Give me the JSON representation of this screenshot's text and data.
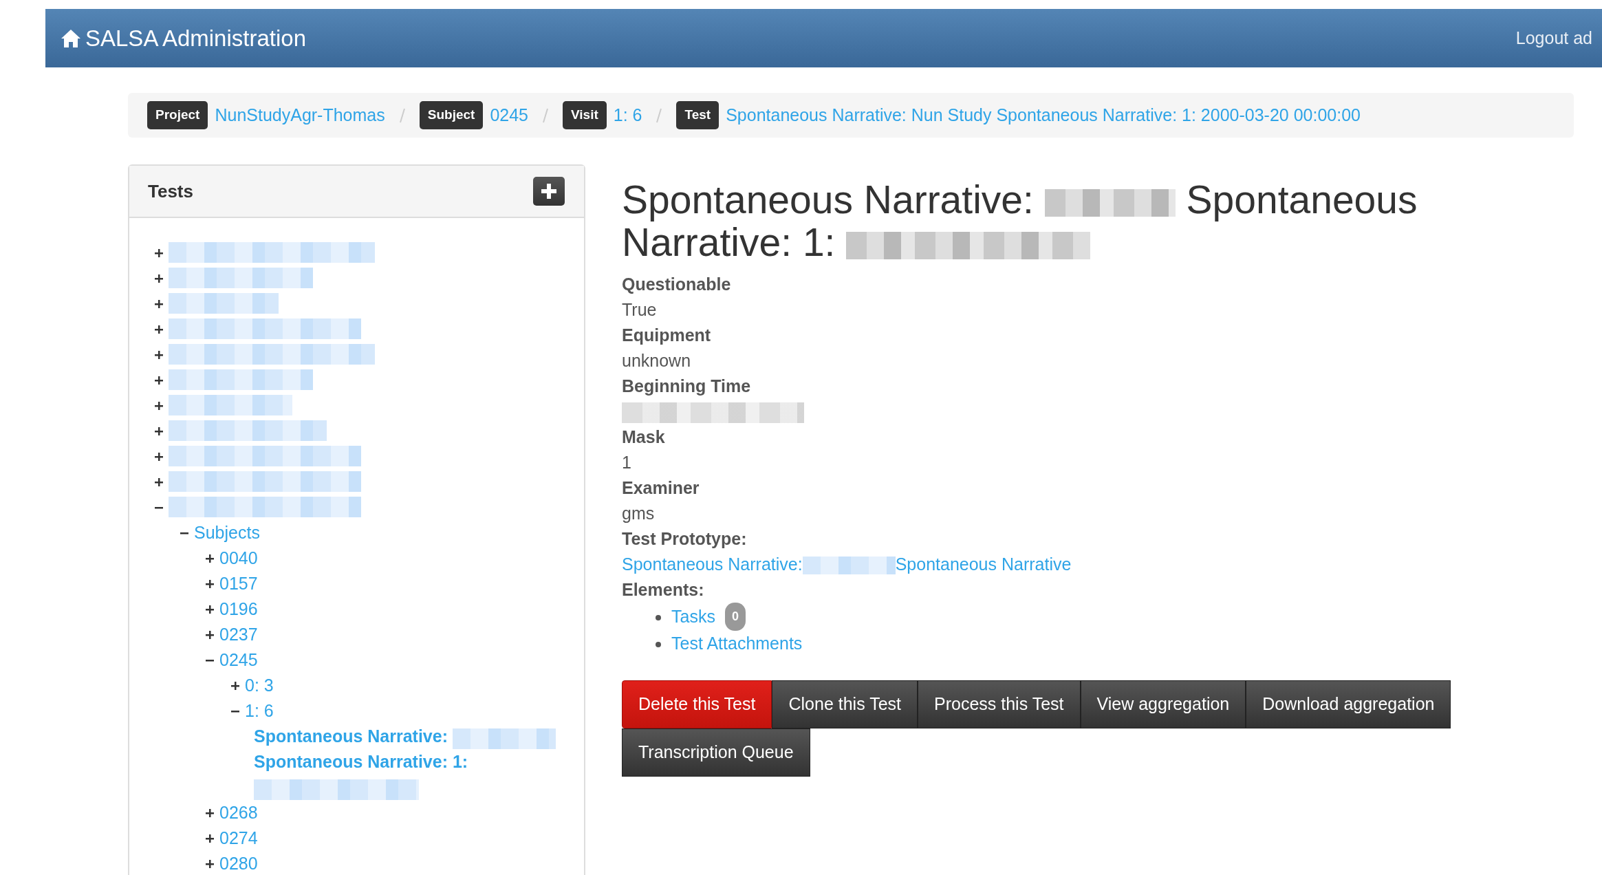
{
  "navbar": {
    "brand": "SALSA Administration",
    "logout": "Logout ad"
  },
  "breadcrumb": [
    {
      "tag": "Project",
      "link": "NunStudyAgr-Thomas"
    },
    {
      "tag": "Subject",
      "link": "0245"
    },
    {
      "tag": "Visit",
      "link": "1: 6"
    },
    {
      "tag": "Test",
      "link": "Spontaneous Narrative: Nun Study Spontaneous Narrative: 1: 2000-03-20 00:00:00"
    }
  ],
  "sidebar": {
    "title": "Tests",
    "tree": [
      {
        "kind": "redacted",
        "expanded": false
      },
      {
        "kind": "redacted",
        "expanded": false
      },
      {
        "kind": "redacted",
        "expanded": false
      },
      {
        "kind": "redacted",
        "expanded": false
      },
      {
        "kind": "redacted",
        "expanded": false
      },
      {
        "kind": "redacted",
        "expanded": false
      },
      {
        "kind": "redacted",
        "expanded": false
      },
      {
        "kind": "redacted",
        "expanded": false
      },
      {
        "kind": "redacted",
        "expanded": false
      },
      {
        "kind": "redacted",
        "expanded": false
      },
      {
        "kind": "redacted",
        "expanded": true,
        "children": [
          {
            "kind": "node",
            "label": "Subjects",
            "expanded": true,
            "children": [
              {
                "kind": "node",
                "label": "0040",
                "expanded": false
              },
              {
                "kind": "node",
                "label": "0157",
                "expanded": false
              },
              {
                "kind": "node",
                "label": "0196",
                "expanded": false
              },
              {
                "kind": "node",
                "label": "0237",
                "expanded": false
              },
              {
                "kind": "node",
                "label": "0245",
                "expanded": true,
                "children": [
                  {
                    "kind": "node",
                    "label": "0: 3",
                    "expanded": false
                  },
                  {
                    "kind": "node",
                    "label": "1: 6",
                    "expanded": true,
                    "children": [
                      {
                        "kind": "test",
                        "selected": true,
                        "parts": [
                          {
                            "kind": "text",
                            "text": "Spontaneous Narrative:"
                          },
                          {
                            "kind": "redacted"
                          },
                          {
                            "kind": "text",
                            "text": "Spontaneous Narrative: 1:"
                          },
                          {
                            "kind": "redacted"
                          }
                        ]
                      }
                    ]
                  }
                ]
              },
              {
                "kind": "node",
                "label": "0268",
                "expanded": false
              },
              {
                "kind": "node",
                "label": "0274",
                "expanded": false
              },
              {
                "kind": "node",
                "label": "0280",
                "expanded": false
              }
            ]
          }
        ]
      }
    ]
  },
  "detail": {
    "title_parts": [
      {
        "kind": "text",
        "text": "Spontaneous Narrative:"
      },
      {
        "kind": "redacted"
      },
      {
        "kind": "text",
        "text": "Spontaneous Narrative: 1:"
      },
      {
        "kind": "redacted"
      }
    ],
    "fields": [
      {
        "label": "Questionable",
        "kind": "text",
        "value": "True"
      },
      {
        "label": "Equipment",
        "kind": "text",
        "value": "unknown"
      },
      {
        "label": "Beginning Time",
        "kind": "redacted"
      },
      {
        "label": "Mask",
        "kind": "text",
        "value": "1"
      },
      {
        "label": "Examiner",
        "kind": "text",
        "value": "gms"
      },
      {
        "label": "Test Prototype:",
        "kind": "link",
        "parts": [
          {
            "kind": "text",
            "text": "Spontaneous Narrative:"
          },
          {
            "kind": "redacted"
          },
          {
            "kind": "text",
            "text": "Spontaneous Narrative"
          }
        ]
      },
      {
        "label": "Elements:",
        "kind": "list",
        "items": [
          {
            "label": "Tasks",
            "count": "0"
          },
          {
            "label": "Test Attachments"
          }
        ]
      }
    ],
    "buttons": [
      {
        "label": "Delete this Test",
        "kind": "danger"
      },
      {
        "label": "Clone this Test",
        "kind": "dark"
      },
      {
        "label": "Process this Test",
        "kind": "dark"
      },
      {
        "label": "View aggregation",
        "kind": "dark"
      },
      {
        "label": "Download aggregation",
        "kind": "dark"
      },
      {
        "label": "Transcription Queue",
        "kind": "dark"
      }
    ]
  }
}
